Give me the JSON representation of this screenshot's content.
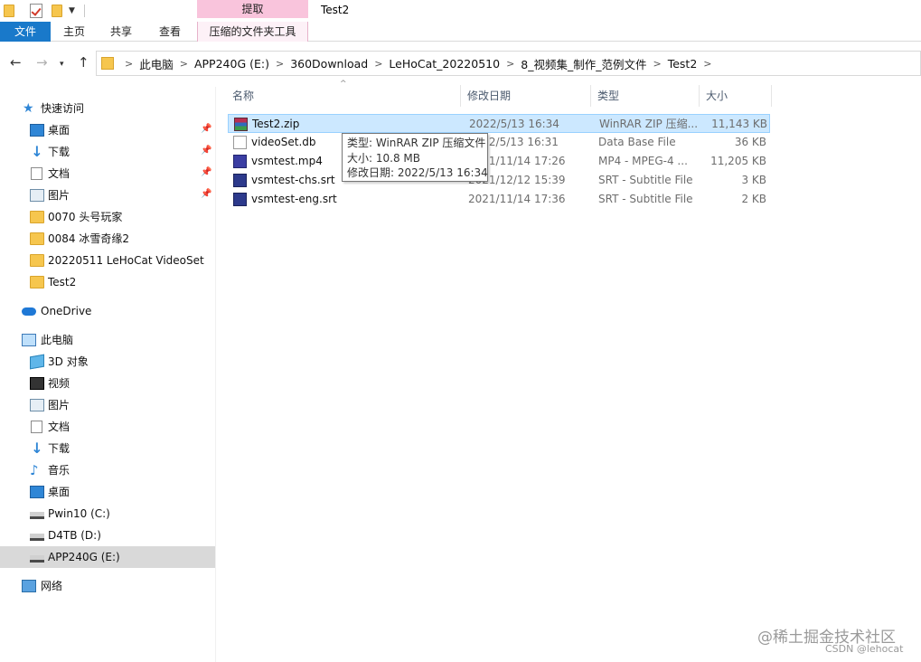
{
  "window": {
    "title": "Test2"
  },
  "ribbon": {
    "contextual_group": "提取",
    "tabs": [
      "文件",
      "主页",
      "共享",
      "查看",
      "压缩的文件夹工具"
    ]
  },
  "address_bar": {
    "crumbs": [
      "此电脑",
      "APP240G (E:)",
      "360Download",
      "LeHoCat_20220510",
      "8_视频集_制作_范例文件",
      "Test2"
    ]
  },
  "sidebar": {
    "quick_access": {
      "label": "快速访问",
      "items": [
        {
          "label": "桌面",
          "icon": "desktop-icon",
          "pinned": true
        },
        {
          "label": "下载",
          "icon": "download-icon",
          "pinned": true
        },
        {
          "label": "文档",
          "icon": "document-icon",
          "pinned": true
        },
        {
          "label": "图片",
          "icon": "pictures-icon",
          "pinned": true
        },
        {
          "label": "0070 头号玩家",
          "icon": "folder-icon",
          "pinned": false
        },
        {
          "label": "0084 冰雪奇缘2",
          "icon": "folder-icon",
          "pinned": false
        },
        {
          "label": "20220511 LeHoCat VideoSet",
          "icon": "folder-icon",
          "pinned": false
        },
        {
          "label": "Test2",
          "icon": "folder-icon",
          "pinned": false
        }
      ]
    },
    "onedrive": {
      "label": "OneDrive"
    },
    "this_pc": {
      "label": "此电脑",
      "items": [
        {
          "label": "3D 对象",
          "icon": "3d-objects-icon"
        },
        {
          "label": "视频",
          "icon": "videos-icon"
        },
        {
          "label": "图片",
          "icon": "pictures-icon"
        },
        {
          "label": "文档",
          "icon": "document-icon"
        },
        {
          "label": "下载",
          "icon": "download-icon"
        },
        {
          "label": "音乐",
          "icon": "music-icon"
        },
        {
          "label": "桌面",
          "icon": "desktop-icon"
        },
        {
          "label": "Pwin10 (C:)",
          "icon": "drive-icon"
        },
        {
          "label": "D4TB (D:)",
          "icon": "drive-icon"
        },
        {
          "label": "APP240G (E:)",
          "icon": "drive-icon",
          "selected": true
        }
      ]
    },
    "network": {
      "label": "网络"
    }
  },
  "file_list": {
    "columns": [
      "名称",
      "修改日期",
      "类型",
      "大小"
    ],
    "rows": [
      {
        "name": "Test2.zip",
        "date": "2022/5/13 16:34",
        "type": "WinRAR ZIP 压缩...",
        "size": "11,143 KB",
        "icon": "zip-icon",
        "selected": true
      },
      {
        "name": "videoSet.db",
        "date": "2022/5/13 16:31",
        "type": "Data Base File",
        "size": "36 KB",
        "icon": "db-file-icon"
      },
      {
        "name": "vsmtest.mp4",
        "date": "2021/11/14 17:26",
        "type": "MP4 - MPEG-4 ...",
        "size": "11,205 KB",
        "icon": "mp4-icon"
      },
      {
        "name": "vsmtest-chs.srt",
        "date": "2021/12/12 15:39",
        "type": "SRT - Subtitle File",
        "size": "3 KB",
        "icon": "srt-icon"
      },
      {
        "name": "vsmtest-eng.srt",
        "date": "2021/11/14 17:36",
        "type": "SRT - Subtitle File",
        "size": "2 KB",
        "icon": "srt-icon"
      }
    ]
  },
  "tooltip": {
    "type_line": "类型: WinRAR ZIP 压缩文件",
    "size_line": "大小: 10.8 MB",
    "date_line": "修改日期: 2022/5/13 16:34"
  },
  "watermark": {
    "line1": "@稀土掘金技术社区",
    "line2": "CSDN @lehocat"
  },
  "colors": {
    "file_tab": "#1979ca",
    "contextual_tab": "#f9c4dc",
    "selection": "#cce8ff",
    "selection_border": "#99d1ff"
  }
}
